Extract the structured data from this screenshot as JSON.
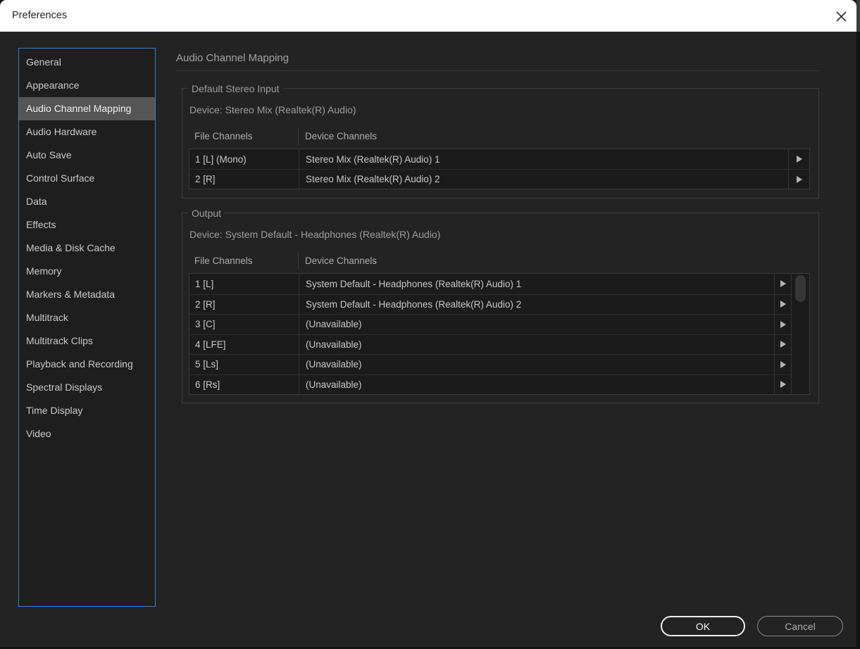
{
  "window": {
    "title": "Preferences"
  },
  "icons": {
    "close": "x-icon",
    "row_dropdown": "right-triangle-icon"
  },
  "colors": {
    "accent_blue_border": "#3b7dc1",
    "selected_item_bg": "#555555",
    "dialog_bg": "#232323",
    "titlebar_bg": "#ffffff",
    "table_bg": "#1b1b1b",
    "group_border": "#3d3d3d",
    "ok_focus_border": "#ededed"
  },
  "sidebar": {
    "items": [
      {
        "label": "General",
        "selected": false
      },
      {
        "label": "Appearance",
        "selected": false
      },
      {
        "label": "Audio Channel Mapping",
        "selected": true
      },
      {
        "label": "Audio Hardware",
        "selected": false
      },
      {
        "label": "Auto Save",
        "selected": false
      },
      {
        "label": "Control Surface",
        "selected": false
      },
      {
        "label": "Data",
        "selected": false
      },
      {
        "label": "Effects",
        "selected": false
      },
      {
        "label": "Media & Disk Cache",
        "selected": false
      },
      {
        "label": "Memory",
        "selected": false
      },
      {
        "label": "Markers & Metadata",
        "selected": false
      },
      {
        "label": "Multitrack",
        "selected": false
      },
      {
        "label": "Multitrack Clips",
        "selected": false
      },
      {
        "label": "Playback and Recording",
        "selected": false
      },
      {
        "label": "Spectral Displays",
        "selected": false
      },
      {
        "label": "Time Display",
        "selected": false
      },
      {
        "label": "Video",
        "selected": false
      }
    ]
  },
  "main": {
    "heading": "Audio Channel Mapping",
    "groups": [
      {
        "title": "Default Stereo Input",
        "device_label": "Device: Stereo Mix (Realtek(R) Audio)",
        "columns": [
          "File Channels",
          "Device Channels"
        ],
        "rows": [
          {
            "file": "1 [L] (Mono)",
            "device": "Stereo Mix (Realtek(R) Audio) 1"
          },
          {
            "file": "2 [R]",
            "device": "Stereo Mix (Realtek(R) Audio) 2"
          }
        ]
      },
      {
        "title": "Output",
        "device_label": "Device: System Default - Headphones (Realtek(R) Audio)",
        "columns": [
          "File Channels",
          "Device Channels"
        ],
        "rows": [
          {
            "file": "1 [L]",
            "device": "System Default - Headphones (Realtek(R) Audio) 1"
          },
          {
            "file": "2 [R]",
            "device": "System Default - Headphones (Realtek(R) Audio) 2"
          },
          {
            "file": "3 [C]",
            "device": "(Unavailable)"
          },
          {
            "file": "4 [LFE]",
            "device": "(Unavailable)"
          },
          {
            "file": "5 [Ls]",
            "device": "(Unavailable)"
          },
          {
            "file": "6 [Rs]",
            "device": "(Unavailable)"
          }
        ]
      }
    ]
  },
  "footer": {
    "ok_label": "OK",
    "cancel_label": "Cancel"
  }
}
